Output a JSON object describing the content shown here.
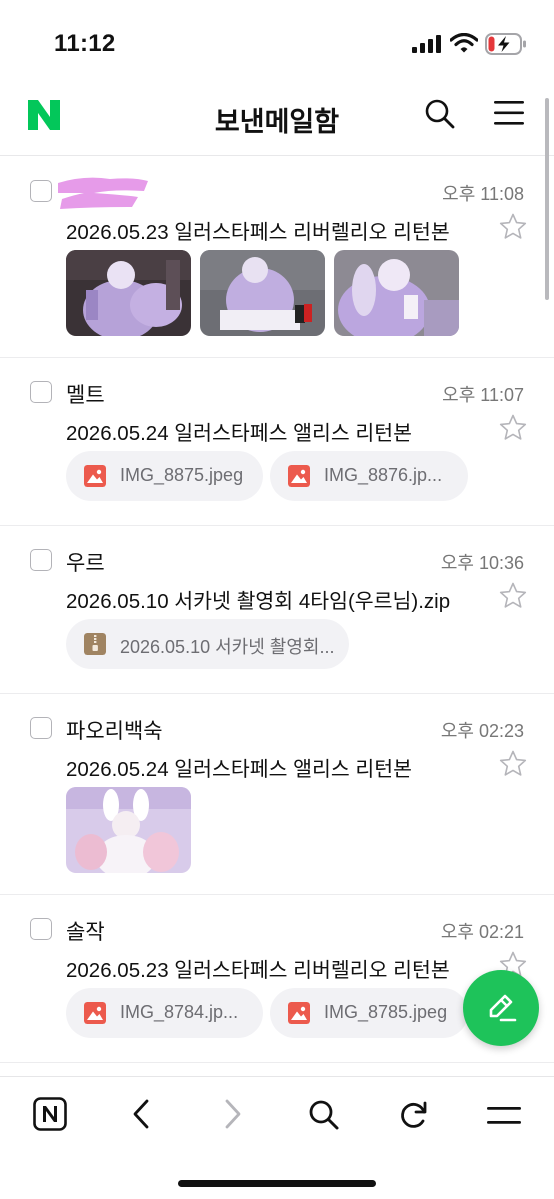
{
  "status": {
    "time": "11:12"
  },
  "header": {
    "title": "보낸메일함"
  },
  "colors": {
    "brand": "#03c75a",
    "fab": "#1ec35a",
    "image_icon": "#ec5a4d",
    "zip_icon": "#a08462",
    "redaction": "#e69be9"
  },
  "mails": [
    {
      "sender": "",
      "time": "오후 11:08",
      "subject": "2026.05.23 일러스타페스 리버렐리오 리턴본",
      "attachment_type": "photo-thumbnails",
      "thumbnail_count": 3
    },
    {
      "sender": "멜트",
      "time": "오후 11:07",
      "subject": "2026.05.24 일러스타페스 앨리스 리턴본",
      "attachments": [
        {
          "icon": "image-file-icon",
          "name": "IMG_8875.jpeg"
        },
        {
          "icon": "image-file-icon",
          "name": "IMG_8876.jp..."
        }
      ]
    },
    {
      "sender": "우르",
      "time": "오후 10:36",
      "subject": "2026.05.10 서카넷 촬영회 4타임(우르님).zip",
      "attachments": [
        {
          "icon": "zip-file-icon",
          "name": "2026.05.10 서카넷 촬영회..."
        }
      ]
    },
    {
      "sender": "파오리백숙",
      "time": "오후 02:23",
      "subject": "2026.05.24 일러스타페스 앨리스 리턴본",
      "attachment_type": "photo-thumbnails",
      "thumbnail_count": 1
    },
    {
      "sender": "솔작",
      "time": "오후 02:21",
      "subject": "2026.05.23 일러스타페스 리버렐리오 리턴본",
      "attachments": [
        {
          "icon": "image-file-icon",
          "name": "IMG_8784.jp..."
        },
        {
          "icon": "image-file-icon",
          "name": "IMG_8785.jpeg"
        }
      ]
    }
  ],
  "bottom_nav": [
    "naver-home-icon",
    "back-icon",
    "forward-icon",
    "search-icon",
    "refresh-icon",
    "menu-icon"
  ]
}
